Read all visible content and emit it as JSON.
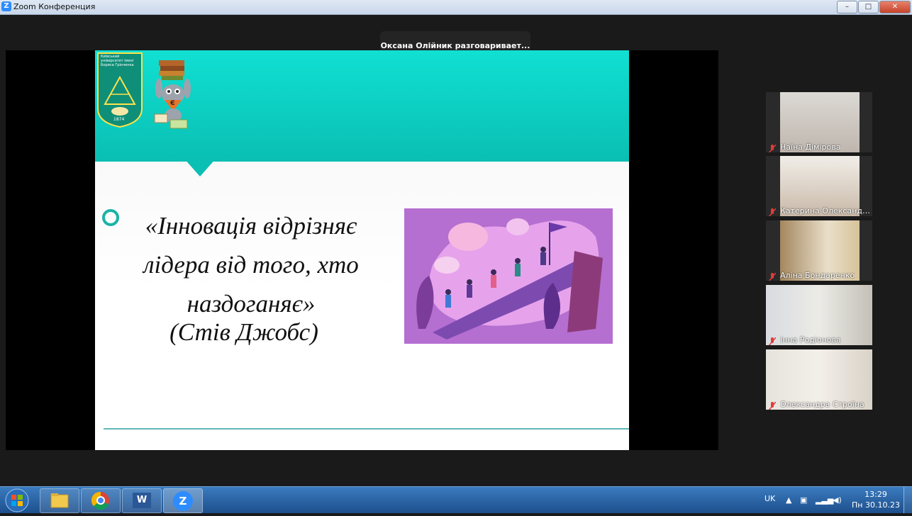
{
  "window": {
    "app_title": "Zoom Конференция",
    "controls": {
      "minimize": "–",
      "maximize": "□",
      "close": "✕"
    }
  },
  "active_speaker": "Оксана Олійник разговаривает...",
  "slide": {
    "quote": "«Інновація відрізняє лідера від того, хто наздоганяє»",
    "author": "(Стів Джобс)",
    "logo_lines": "Київський університет імені Бориса Грінченка",
    "logo_year": "1874",
    "mascot_letter": "Є",
    "colors": {
      "header": "#0abfb3",
      "accent": "#1bb3a7",
      "illustration": "#c07ad8"
    }
  },
  "participants": [
    {
      "name": "Наїна Дімірова",
      "muted": true
    },
    {
      "name": "Катерина Олександр...",
      "muted": true
    },
    {
      "name": "Аліна Бондаренко",
      "muted": true
    },
    {
      "name": "Інна Родіонова",
      "muted": true
    },
    {
      "name": "Олександра Строїна",
      "muted": true
    }
  ],
  "taskbar": {
    "apps": [
      "file-explorer",
      "chrome",
      "word",
      "zoom"
    ],
    "word_label": "W",
    "zoom_label": "Z",
    "language": "UK",
    "time": "13:29",
    "date": "Пн 30.10.23"
  }
}
